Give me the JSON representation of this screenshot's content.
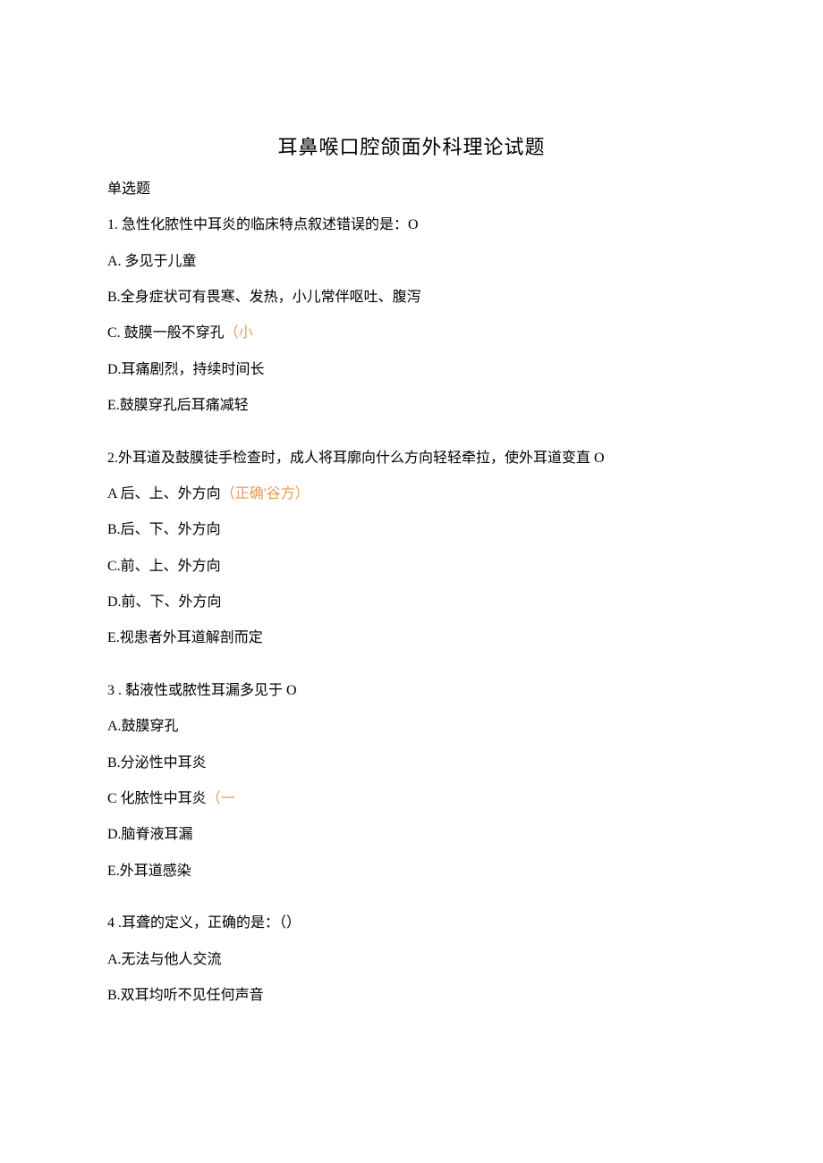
{
  "title": "耳鼻喉口腔颌面外科理论试题",
  "section": "单选题",
  "q1": {
    "stem": "1. 急性化脓性中耳炎的临床特点叙述错误的是：O",
    "A": "A. 多见于儿童",
    "B": "B.全身症状可有畏寒、发热，小儿常伴呕吐、腹泻",
    "C_pre": "C. 鼓膜一般不穿孔",
    "C_ans": "（小",
    "D": "D.耳痛剧烈，持续时间长",
    "E": "E.鼓膜穿孔后耳痛减轻"
  },
  "q2": {
    "stem": "2.外耳道及鼓膜徒手检查时，成人将耳廓向什么方向轻轻牵拉，使外耳道变直 O",
    "A_pre": "A 后、上、外方向",
    "A_ans": "（正确'谷方）",
    "B": "B.后、下、外方向",
    "C": "C.前、上、外方向",
    "D": "D.前、下、外方向",
    "E": "E.视患者外耳道解剖而定"
  },
  "q3": {
    "stem": "3  . 黏液性或脓性耳漏多见于 O",
    "A": "A.鼓膜穿孔",
    "B": "B.分泌性中耳炎",
    "C_pre": "C 化脓性中耳炎",
    "C_ans": "（一",
    "D": "D.脑脊液耳漏",
    "E": "E.外耳道感染"
  },
  "q4": {
    "stem": "4  .耳聋的定义，正确的是：（）",
    "A": "A.无法与他人交流",
    "B": "B.双耳均听不见任何声音"
  }
}
